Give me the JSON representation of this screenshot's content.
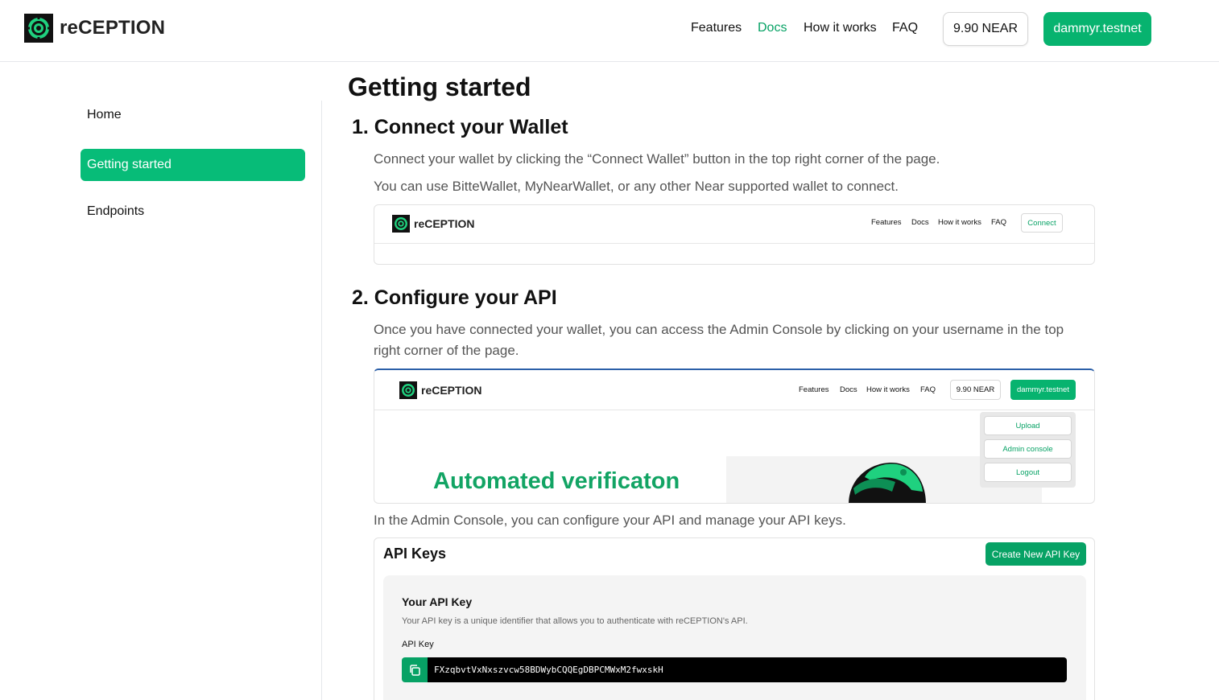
{
  "header": {
    "brand": "reCEPTION",
    "nav": [
      "Features",
      "Docs",
      "How it works",
      "FAQ"
    ],
    "balance": "9.90 NEAR",
    "account": "dammyr.testnet"
  },
  "sidebar": {
    "items": [
      {
        "label": "Home"
      },
      {
        "label": "Getting started"
      },
      {
        "label": "Endpoints"
      }
    ]
  },
  "main": {
    "title": "Getting started",
    "step1": {
      "heading": "1. Connect your Wallet",
      "para1": "Connect your wallet by clicking the “Connect Wallet” button in the top right corner of the page.",
      "para2": "You can use BitteWallet, MyNearWallet, or any other Near supported wallet to connect.",
      "preview": {
        "brand": "reCEPTION",
        "nav": [
          "Features",
          "Docs",
          "How it works",
          "FAQ"
        ],
        "connect": "Connect"
      }
    },
    "step2": {
      "heading": "2. Configure your API",
      "para1_line1": "Once you have connected your wallet, you can access the Admin Console by clicking on your username in the top",
      "para1_line2": "right corner of the page.",
      "preview": {
        "brand": "reCEPTION",
        "nav": [
          "Features",
          "Docs",
          "How it works",
          "FAQ"
        ],
        "balance": "9.90 NEAR",
        "account": "dammyr.testnet",
        "menu": [
          "Upload",
          "Admin console",
          "Logout"
        ],
        "hero": "Automated verificaton"
      },
      "para2": "In the Admin Console, you can configure your API and manage your API keys.",
      "api_card": {
        "title": "API Keys",
        "create_button": "Create New API Key",
        "panel_title": "Your API Key",
        "panel_desc": "Your API key is a unique identifier that allows you to authenticate with reCEPTION's API.",
        "key_label": "API Key",
        "key_value": "FXzqbvtVxNxszvcw58BDWybCQQEgDBPCMWxM2fwxskH"
      }
    }
  },
  "colors": {
    "accent": "#07b36f",
    "accent_dark": "#07a265",
    "hero_green": "#12a464"
  }
}
